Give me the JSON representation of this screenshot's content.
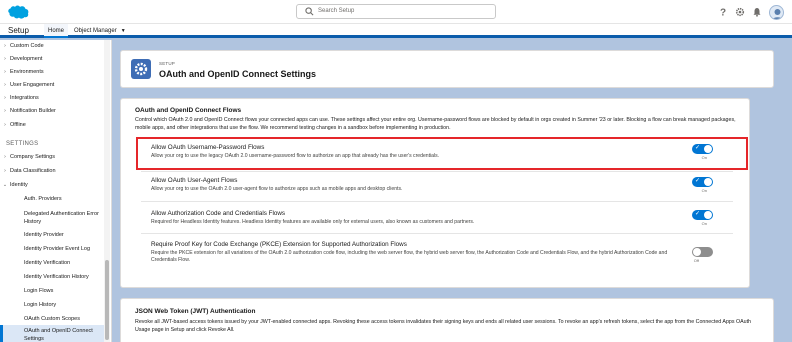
{
  "header": {
    "search_placeholder": "Search Setup",
    "icons": [
      "help-icon",
      "gear-icon",
      "notification-icon",
      "user-avatar"
    ]
  },
  "nav": {
    "app_name": "Setup",
    "tabs": [
      {
        "label": "Home",
        "active": true
      },
      {
        "label": "Object Manager",
        "active": false
      }
    ]
  },
  "sidebar": {
    "top_items": [
      "Custom Code",
      "Development",
      "Environments",
      "User Engagement",
      "Integrations",
      "Notification Builder",
      "Offline"
    ],
    "section_heading": "SETTINGS",
    "settings_items": [
      "Company Settings",
      "Data Classification",
      "Identity"
    ],
    "identity_children": [
      "Auth. Providers",
      "Delegated Authentication Error History",
      "Identity Provider",
      "Identity Provider Event Log",
      "Identity Verification",
      "Identity Verification History",
      "Login Flows",
      "Login History",
      "OAuth Custom Scopes",
      "OAuth and OpenID Connect Settings"
    ],
    "active_item": "OAuth and OpenID Connect Settings"
  },
  "page": {
    "eyebrow": "SETUP",
    "title": "OAuth and OpenID Connect Settings"
  },
  "flows": {
    "heading": "OAuth and OpenID Connect Flows",
    "description": "Control which OAuth 2.0 and OpenID Connect flows your connected apps can use. These settings affect your entire org. Username-password flows are blocked by default in orgs created in Summer '23 or later. Blocking a flow can break managed packages, mobile apps, and other integrations that use the flow. We recommend testing changes in a sandbox before implementing in production.",
    "rows": [
      {
        "title": "Allow OAuth Username-Password Flows",
        "description": "Allow your org to use the legacy OAuth 2.0 username-password flow to authorize an app that already has the user's credentials.",
        "toggle_label": "On",
        "enabled": true
      },
      {
        "title": "Allow OAuth User-Agent Flows",
        "description": "Allow your org to use the OAuth 2.0 user-agent flow to authorize apps such as mobile apps and desktop clients.",
        "toggle_label": "On",
        "enabled": true
      },
      {
        "title": "Allow Authorization Code and Credentials Flows",
        "description": "Required for Headless Identity features. Headless Identity features are available only for external users, also known as customers and partners.",
        "toggle_label": "On",
        "enabled": true
      },
      {
        "title": "Require Proof Key for Code Exchange (PKCE) Extension for Supported Authorization Flows",
        "description": "Require the PKCE extension for all variations of the OAuth 2.0 authorization code flow, including the web server flow, the hybrid web server flow, the Authorization Code and Credentials Flow, and the hybrid Authorization Code and Credentials Flow.",
        "toggle_label": "Off",
        "enabled": false
      }
    ]
  },
  "jwt": {
    "heading": "JSON Web Token (JWT) Authentication",
    "description": "Revoke all JWT-based access tokens issued by your JWT-enabled connected apps. Revoking these access tokens invalidates their signing keys and ends all related user sessions. To revoke an app's refresh tokens, select the app from the Connected Apps OAuth Usage page in Setup and click Revoke All."
  },
  "colors": {
    "brand": "#0176d3",
    "highlight": "#e5262a",
    "background": "#b0c4df"
  }
}
